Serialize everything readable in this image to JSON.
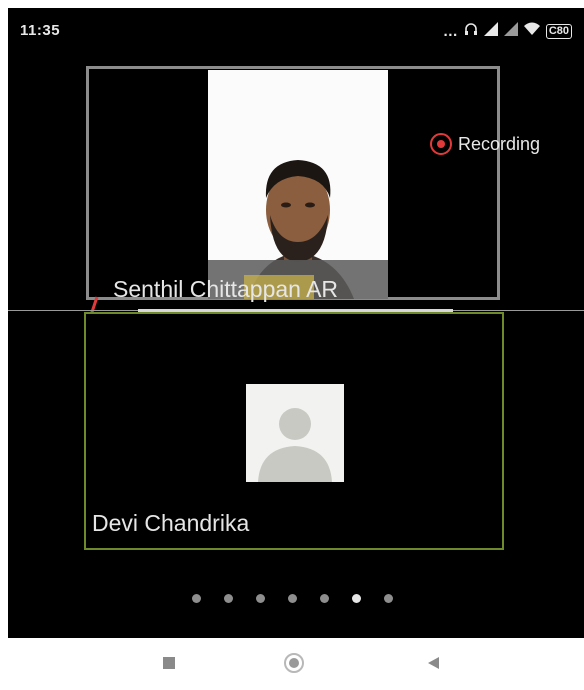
{
  "status_bar": {
    "time": "11:35",
    "icons": [
      "dots-icon",
      "headphones-icon",
      "signal-icon",
      "signal-icon-2",
      "wifi-icon",
      "battery-icon"
    ],
    "battery": "C80"
  },
  "meeting": {
    "recording_label": "Recording",
    "participants": [
      {
        "name": "Senthil Chittappan AR",
        "muted": true,
        "video_on": true
      },
      {
        "name": "Devi Chandrika",
        "muted": false,
        "video_on": false
      }
    ],
    "page_dots": {
      "count": 7,
      "active_index": 5
    }
  },
  "colors": {
    "active_speaker_border": "#6e8a2a",
    "tile_border": "#8c8c8c",
    "recording_red": "#e23a3a"
  },
  "nav": {
    "buttons": [
      "recent-apps-icon",
      "home-icon",
      "back-icon"
    ]
  }
}
